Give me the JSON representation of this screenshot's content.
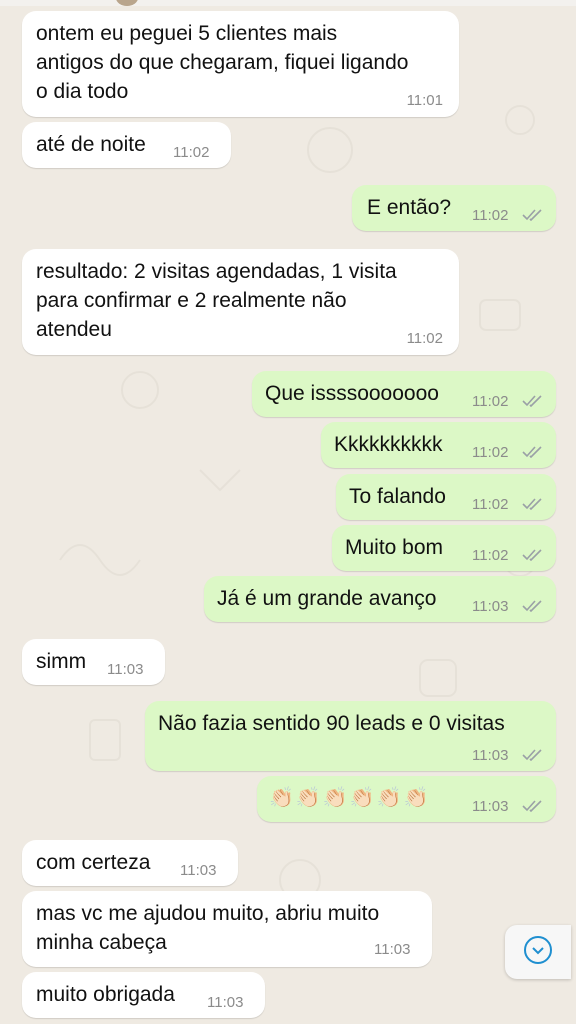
{
  "messages": [
    {
      "dir": "in",
      "text": "ontem eu peguei 5 clientes mais\nantigos do que chegaram, fiquei ligando\no dia todo",
      "time": "11:01"
    },
    {
      "dir": "in",
      "text": "até de noite",
      "time": "11:02"
    },
    {
      "dir": "out",
      "text": "E então?",
      "time": "11:02"
    },
    {
      "dir": "in",
      "text": "resultado: 2 visitas agendadas, 1 visita\npara confirmar e 2 realmente não\natendeu",
      "time": "11:02"
    },
    {
      "dir": "out",
      "text": "Que issssooooooo",
      "time": "11:02"
    },
    {
      "dir": "out",
      "text": "Kkkkkkkkkk",
      "time": "11:02"
    },
    {
      "dir": "out",
      "text": "To falando",
      "time": "11:02"
    },
    {
      "dir": "out",
      "text": "Muito bom",
      "time": "11:02"
    },
    {
      "dir": "out",
      "text": "Já é um grande avanço",
      "time": "11:03"
    },
    {
      "dir": "in",
      "text": "simm",
      "time": "11:03"
    },
    {
      "dir": "out",
      "text": "Não fazia sentido 90 leads e 0 visitas",
      "time": "11:03"
    },
    {
      "dir": "out",
      "text": "👏🏻👏🏻👏🏻👏🏻👏🏻👏🏻",
      "time": "11:03"
    },
    {
      "dir": "in",
      "text": "com certeza",
      "time": "11:03"
    },
    {
      "dir": "in",
      "text": "mas vc me ajudou muito, abriu muito\nminha cabeça",
      "time": "11:03"
    },
    {
      "dir": "in",
      "text": "muito obrigada",
      "time": "11:03"
    }
  ],
  "colors": {
    "incoming": "#ffffff",
    "outgoing": "#dcf8c6",
    "time": "#8b8b8b",
    "read_ticks": "#9aa0a6",
    "accent": "#1f8fd0"
  },
  "icons": {
    "read_receipt": "double-check-icon",
    "scroll_down": "chevron-down-icon"
  }
}
